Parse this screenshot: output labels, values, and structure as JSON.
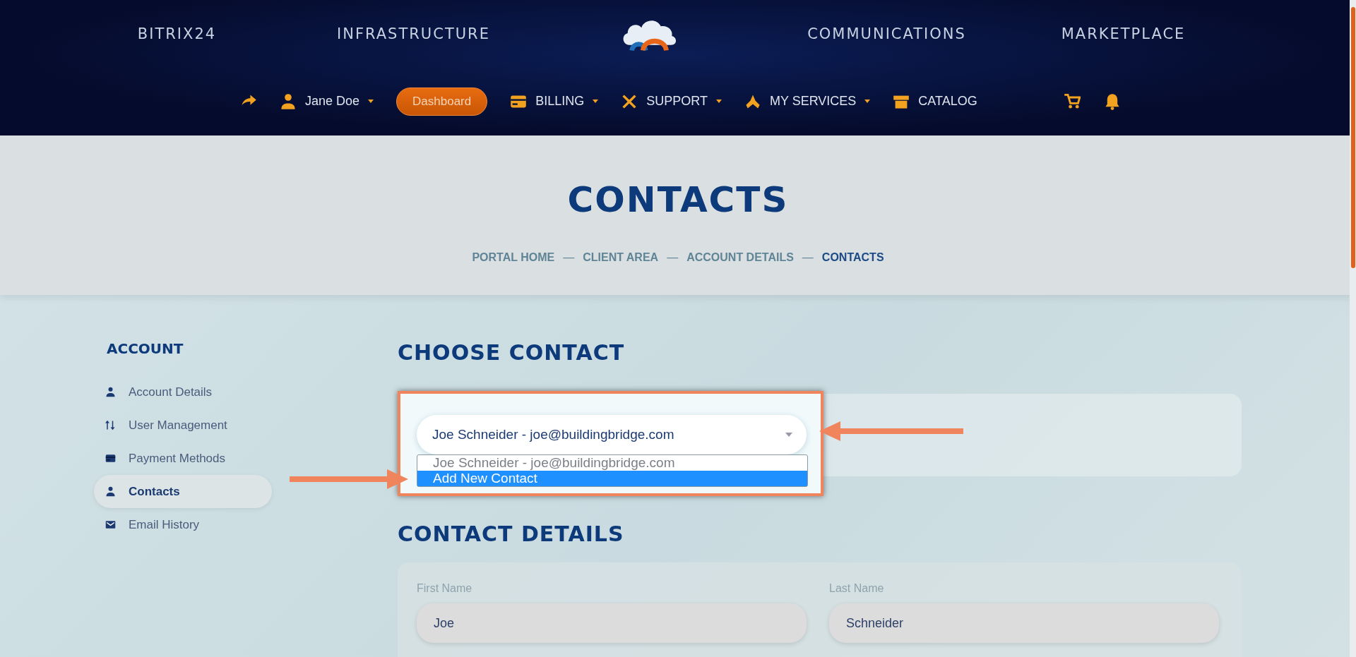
{
  "header": {
    "links_left": [
      {
        "label": "BITRIX24"
      },
      {
        "label": "INFRASTRUCTURE"
      }
    ],
    "links_right": [
      {
        "label": "COMMUNICATIONS"
      },
      {
        "label": "MARKETPLACE"
      }
    ]
  },
  "toolbar": {
    "items": [
      {
        "kind": "icon"
      },
      {
        "kind": "menu",
        "label": "Jane Doe",
        "caret": true
      },
      {
        "kind": "button",
        "label": "Dashboard"
      },
      {
        "kind": "menu",
        "label": "BILLING",
        "caret": true
      },
      {
        "kind": "menu",
        "label": "SUPPORT",
        "caret": true
      },
      {
        "kind": "menu",
        "label": "MY SERVICES",
        "caret": true
      },
      {
        "kind": "menu",
        "label": "CATALOG",
        "caret": false
      }
    ]
  },
  "hero": {
    "title": "CONTACTS",
    "separator": "—",
    "breadcrumb": [
      {
        "label": "PORTAL HOME",
        "selected": false
      },
      {
        "label": "CLIENT AREA",
        "selected": false
      },
      {
        "label": "ACCOUNT DETAILS",
        "selected": false
      },
      {
        "label": "CONTACTS",
        "selected": true
      }
    ]
  },
  "sidebar": {
    "heading": "ACCOUNT",
    "items": [
      {
        "label": "Account Details",
        "selected": false
      },
      {
        "label": "User Management",
        "selected": false
      },
      {
        "label": "Payment Methods",
        "selected": false
      },
      {
        "label": "Contacts",
        "selected": true
      },
      {
        "label": "Email History",
        "selected": false
      }
    ]
  },
  "choose": {
    "heading": "CHOOSE CONTACT",
    "select": {
      "value": "Joe Schneider - joe@buildingbridge.com",
      "expanded": true,
      "options": [
        {
          "label": "Joe Schneider - joe@buildingbridge.com",
          "highlighted": false
        },
        {
          "label": "Add New Contact",
          "highlighted": true
        }
      ]
    }
  },
  "details": {
    "heading": "CONTACT DETAILS",
    "fields": [
      {
        "label": "First Name",
        "value": "Joe"
      },
      {
        "label": "Last Name",
        "value": "Schneider"
      }
    ]
  }
}
